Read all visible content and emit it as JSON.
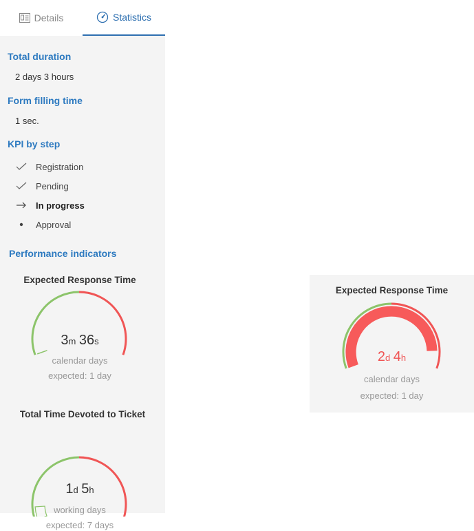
{
  "tabs": {
    "details_label": "Details",
    "statistics_label": "Statistics"
  },
  "sections": {
    "total_duration_title": "Total duration",
    "total_duration_value": "2 days 3 hours",
    "form_filling_title": "Form filling time",
    "form_filling_value": "1 sec.",
    "kpi_title": "KPI by step",
    "performance_title": "Performance indicators"
  },
  "steps": [
    {
      "label": "Registration",
      "status": "done",
      "icon": "check-icon"
    },
    {
      "label": "Pending",
      "status": "done",
      "icon": "check-icon"
    },
    {
      "label": "In progress",
      "status": "current",
      "icon": "arrow-right-icon"
    },
    {
      "label": "Approval",
      "status": "upcoming",
      "icon": "bullet-icon"
    }
  ],
  "gauges": [
    {
      "title": "Expected Response Time",
      "value_major": "3",
      "unit_major": "m",
      "value_minor": "36",
      "unit_minor": "s",
      "unit_label": "calendar days",
      "expected": "expected: 1 day",
      "progress_fraction": 0.003
    },
    {
      "title": "Total Time Devoted to Ticket",
      "value_major": "1",
      "unit_major": "d",
      "value_minor": "5",
      "unit_minor": "h",
      "unit_label": "working days",
      "expected": "expected: 7 days",
      "progress_fraction": 0.15
    }
  ],
  "card": {
    "title": "Expected Response Time",
    "value_major": "2",
    "unit_major": "d",
    "value_minor": "4",
    "unit_minor": "h",
    "unit_label": "calendar days",
    "expected": "expected: 1 day",
    "progress_fraction": 2.17
  },
  "colors": {
    "accent": "#2d7ac0",
    "good": "#8cc46a",
    "bad": "#f05555",
    "fill_over": "#f75a5a"
  }
}
